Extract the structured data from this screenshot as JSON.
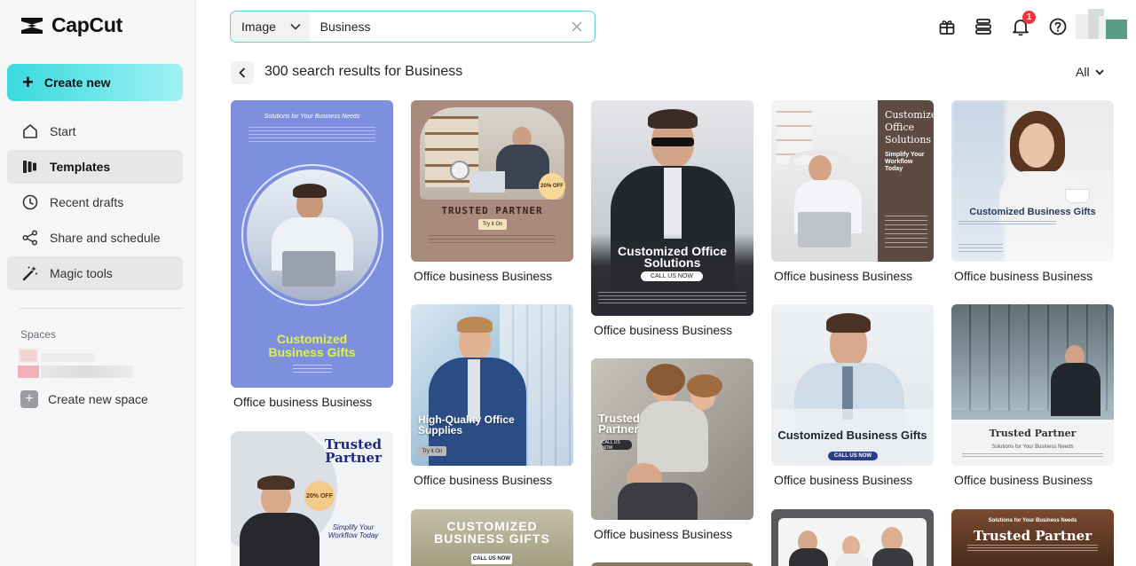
{
  "app": {
    "name": "CapCut"
  },
  "sidebar": {
    "create_label": "Create new",
    "items": [
      {
        "label": "Start",
        "icon": "home-icon"
      },
      {
        "label": "Templates",
        "icon": "templates-icon"
      },
      {
        "label": "Recent drafts",
        "icon": "clock-icon"
      },
      {
        "label": "Share and schedule",
        "icon": "share-icon"
      },
      {
        "label": "Magic tools",
        "icon": "magic-wand-icon"
      }
    ],
    "spaces_label": "Spaces",
    "create_space_label": "Create new space"
  },
  "search": {
    "type_label": "Image",
    "query": "Business"
  },
  "topbar": {
    "notification_count": "1"
  },
  "results": {
    "title": "300 search results for Business",
    "filter_label": "All",
    "cards": [
      {
        "caption": "Office business Business",
        "headline": "Customized Business Gifts",
        "subhead": "Solutions for Your Business Needs"
      },
      {
        "caption": "Office business Business",
        "headline": "TRUSTED PARTNER",
        "button": "Try it On",
        "badge": "20% OFF"
      },
      {
        "caption": "Office business Business",
        "headline": "Customized Office Solutions",
        "button": "CALL US NOW"
      },
      {
        "caption": "Office business Business",
        "headline": "Customized Office Solutions",
        "subhead": "Simplify Your Workflow Today"
      },
      {
        "caption": "Office business Business",
        "headline": "Customized Business Gifts"
      },
      {
        "caption": "Office business Business",
        "headline": "High-Quality Office Supplies",
        "button": "Try it On"
      },
      {
        "caption": "Office business Business",
        "headline": "Trusted Partner",
        "button": "CALL US NOW"
      },
      {
        "caption": "Office business Business",
        "headline": "Customized Business Gifts",
        "button": "CALL US NOW"
      },
      {
        "caption": "Office business Business",
        "headline": "Trusted Partner",
        "subhead": "Solutions for Your Business Needs"
      },
      {
        "caption": "",
        "headline": "Trusted Partner",
        "badge": "20% OFF",
        "subhead": "Simplify Your Workflow Today"
      },
      {
        "caption": "",
        "headline": "CUSTOMIZED BUSINESS GIFTS",
        "button": "CALL US NOW"
      },
      {
        "caption": "",
        "headline": "Trusted Partner",
        "subhead": "Solutions for Your Business Needs"
      }
    ]
  },
  "colors": {
    "accent": "#39d9de",
    "badge": "#f0353e"
  }
}
